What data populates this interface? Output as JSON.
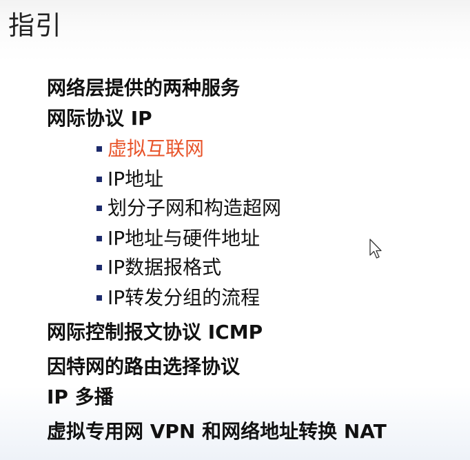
{
  "slide": {
    "title": "指引",
    "items": [
      {
        "label": "网络层提供的两种服务",
        "level": 1
      },
      {
        "label": "网际协议 IP",
        "level": 1
      },
      {
        "label": "虚拟互联网",
        "level": 2,
        "active": true
      },
      {
        "label": "IP地址",
        "level": 2
      },
      {
        "label": "划分子网和构造超网",
        "level": 2
      },
      {
        "label": "IP地址与硬件地址",
        "level": 2
      },
      {
        "label": "IP数据报格式",
        "level": 2
      },
      {
        "label": "IP转发分组的流程",
        "level": 2
      },
      {
        "label": "网际控制报文协议 ICMP",
        "level": 1
      },
      {
        "label": "因特网的路由选择协议",
        "level": 1
      },
      {
        "label": "IP 多播",
        "level": 1
      },
      {
        "label": "虚拟专用网 VPN 和网络地址转换 NAT",
        "level": 1
      }
    ]
  },
  "colors": {
    "active_item": "#e8542a",
    "bullet": "#1c2a6b",
    "text": "#111111"
  },
  "cursor": {
    "icon": "mouse-pointer-icon"
  }
}
